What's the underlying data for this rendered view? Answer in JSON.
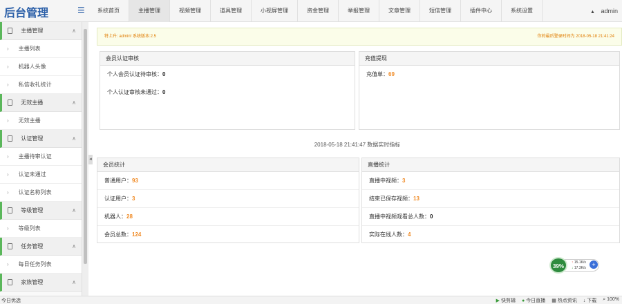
{
  "app": {
    "brand": "后台管理",
    "menu_icon": "hamburger-icon"
  },
  "nav": [
    "系统首页",
    "主播管理",
    "视频管理",
    "道具管理",
    "小视屏管理",
    "资金管理",
    "举报管理",
    "文章管理",
    "短信管理",
    "插件中心",
    "系统设置"
  ],
  "nav_active_index": 1,
  "user": {
    "name": "admin"
  },
  "sidebar": {
    "groups": [
      {
        "label": "主播管理",
        "items": [
          "主播列表",
          "机器人头像",
          "私信收礼统计"
        ]
      },
      {
        "label": "无效主播",
        "items": [
          "无效主播"
        ]
      },
      {
        "label": "认证管理",
        "items": [
          "主播待审认证",
          "认证未通过",
          "认证名称列表"
        ]
      },
      {
        "label": "等级管理",
        "items": [
          "等级列表"
        ]
      },
      {
        "label": "任务管理",
        "items": [
          "每日任务列表"
        ]
      },
      {
        "label": "家族管理",
        "items": []
      }
    ]
  },
  "notice": {
    "left": "特上升: admin! 系统版本:2.5",
    "right": "你的最后登录时间为 2018-05-18 21:41:24"
  },
  "member_audit": {
    "title": "会员认证审核",
    "rows": [
      {
        "label": "个人会员认证待审核：",
        "value": "0"
      },
      {
        "label": "个人认证审核未通过：",
        "value": "0"
      }
    ]
  },
  "recharge": {
    "title": "充值提现",
    "rows": [
      {
        "label": "充值单：",
        "value": "69"
      }
    ]
  },
  "realtime_title": "2018-05-18 21:41:47 数据实时指标",
  "member_stats": {
    "title": "会员统计",
    "rows": [
      {
        "label": "普通用户：",
        "value": "93"
      },
      {
        "label": "认证用户：",
        "value": "3"
      },
      {
        "label": "机器人：",
        "value": "28"
      },
      {
        "label": "会员总数：",
        "value": "124"
      }
    ]
  },
  "live_stats": {
    "title": "直播统计",
    "rows": [
      {
        "label": "直播中视频：",
        "value": "3"
      },
      {
        "label": "结束已保存视频：",
        "value": "13"
      },
      {
        "label": "直播中视频观看总人数：",
        "value": "0"
      },
      {
        "label": "实际在线人数：",
        "value": "4"
      }
    ]
  },
  "speed_widget": {
    "percent": "39%",
    "up": "15.1K/s",
    "down": "17.3K/s"
  },
  "statusbar": {
    "left": "今日优选",
    "right": [
      "快剪辑",
      "今日直播",
      "热点资讯",
      "下载",
      "100%"
    ]
  }
}
